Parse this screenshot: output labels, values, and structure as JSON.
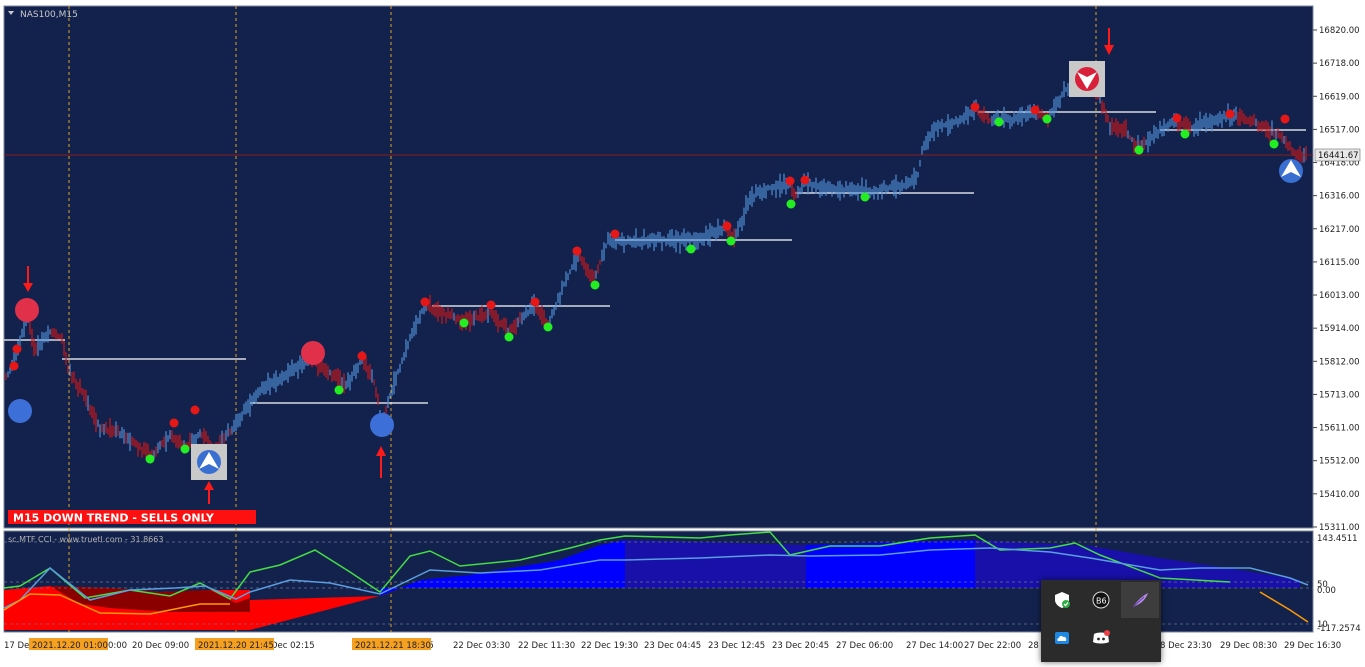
{
  "symbol": "NAS100,M15",
  "trend_banner": "M15  DOWN TREND - SELLS ONLY",
  "current_price_label": "16441.67",
  "indicator_title": "sc.MTF CCI - www.truetl.com - 31.8663",
  "price_axis": [
    "16820.00",
    "16718.00",
    "16619.00",
    "16517.00",
    "16418.00",
    "16316.00",
    "16217.00",
    "16115.00",
    "16013.00",
    "15914.00",
    "15812.00",
    "15713.00",
    "15611.00",
    "15512.00",
    "15410.00",
    "15311.00"
  ],
  "indicator_axis": [
    "143.4511",
    "50",
    "0.00",
    "10",
    "-117.2574"
  ],
  "time_axis": [
    "17 Dec 2021",
    "0:00",
    "20 Dec 09:00",
    "Dec 02:15",
    "15",
    "22 Dec 03:30",
    "22 Dec 11:30",
    "22 Dec 19:30",
    "23 Dec 04:45",
    "23 Dec 12:45",
    "23 Dec 20:45",
    "27 Dec 06:00",
    "27 Dec 14:00",
    "27 Dec 22:00",
    "28",
    "8 Dec 23:30",
    "29 Dec 08:30",
    "29 Dec 16:30"
  ],
  "time_markers": [
    "2021.12.20 01:00",
    "2021.12.20 21:45",
    "2021.12.21 18:30"
  ],
  "colors": {
    "background": "#13224d",
    "bull_bar": "#4f8fd6",
    "bear_bar": "#d01717",
    "buy_dot": "#22ee22",
    "sell_dot": "#e51717",
    "marker_highlight": "#f5a020",
    "cci_green": "#44dd44",
    "cci_blue": "#5a9ee0",
    "cci_orange": "#ff9a00",
    "fill_blue": "#0000ff",
    "fill_red": "#ff0000"
  },
  "tray": {
    "icons": [
      "shield-check-icon",
      "bb-app-icon",
      "feather-pen-icon",
      "onedrive-cloud-icon",
      "discord-icon"
    ]
  }
}
